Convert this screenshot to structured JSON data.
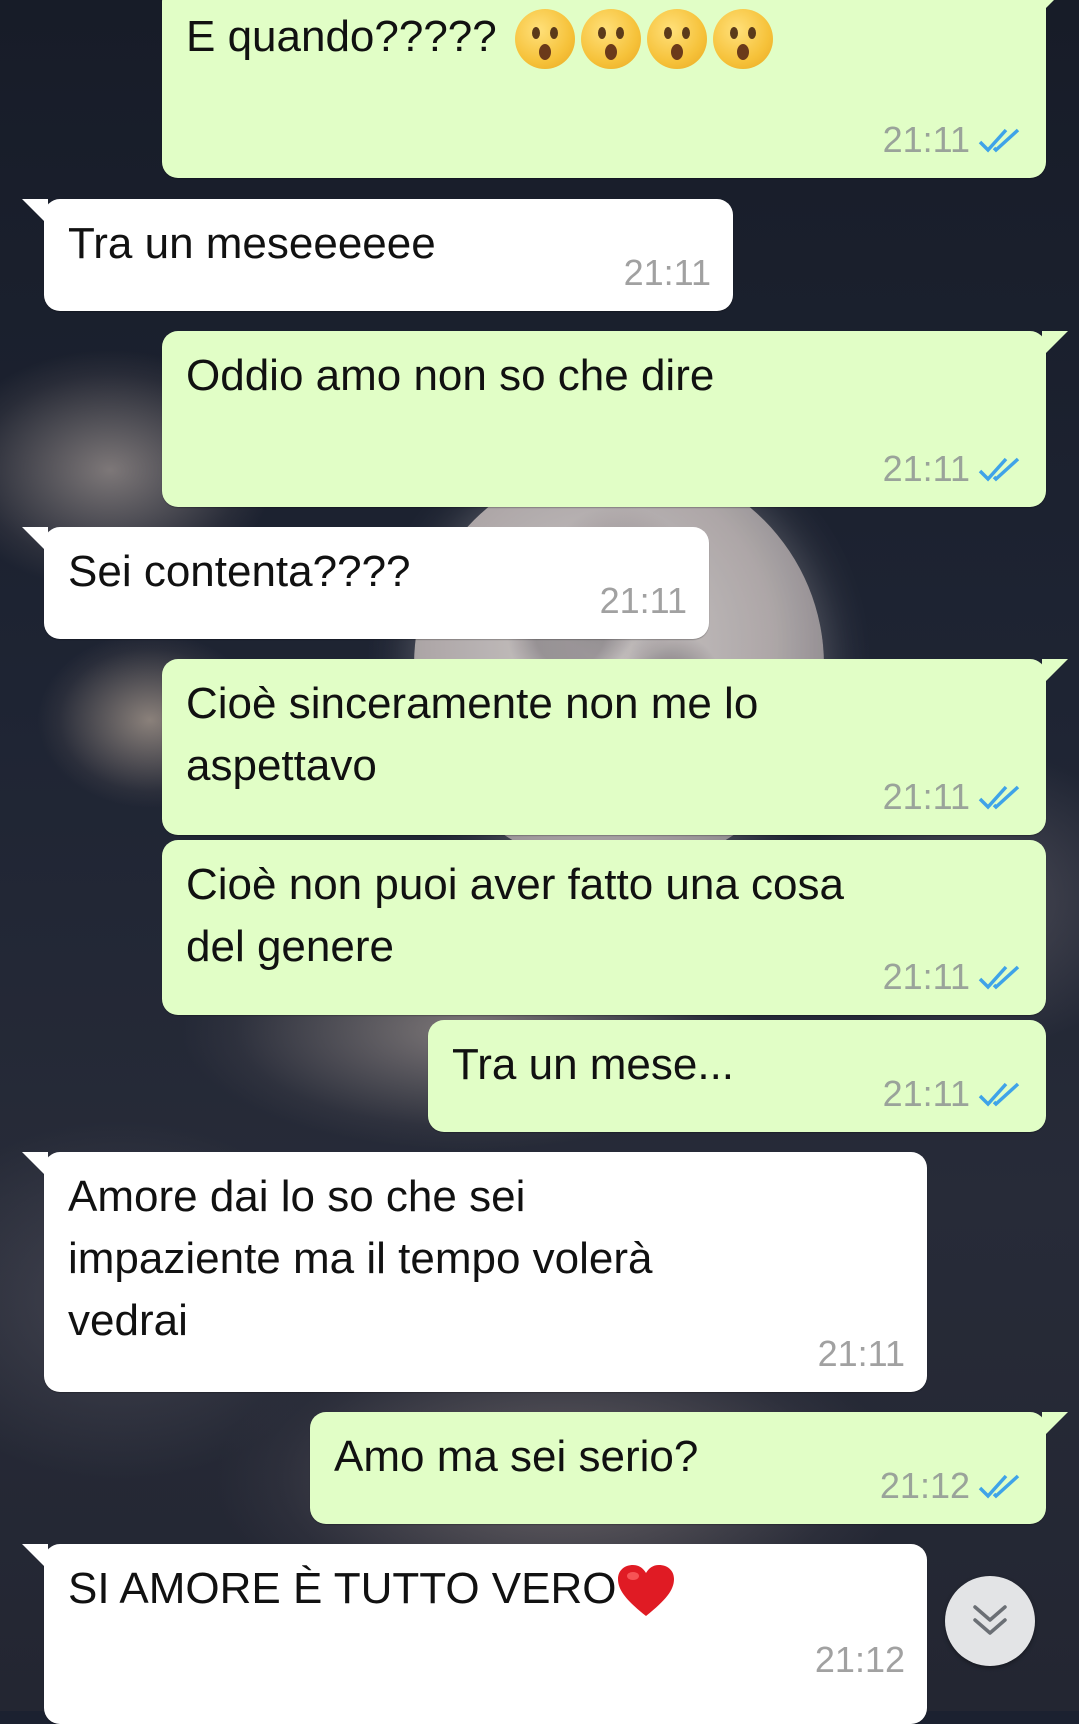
{
  "messages": [
    {
      "direction": "out",
      "text": "E quando?????",
      "emoji_count": 4,
      "emoji": "astonished-face",
      "time": "21:11",
      "status": "read"
    },
    {
      "direction": "in",
      "text": "Tra un meseeeeee",
      "time": "21:11"
    },
    {
      "direction": "out",
      "text": "Oddio amo non so che dire",
      "time": "21:11",
      "status": "read"
    },
    {
      "direction": "in",
      "text": "Sei contenta????",
      "time": "21:11"
    },
    {
      "direction": "out",
      "text": "Cioè sinceramente non me lo\naspettavo",
      "time": "21:11",
      "status": "read"
    },
    {
      "direction": "out",
      "text": "Cioè non puoi aver fatto una cosa\ndel genere",
      "time": "21:11",
      "status": "read"
    },
    {
      "direction": "out",
      "text": "Tra un mese...",
      "time": "21:11",
      "status": "read"
    },
    {
      "direction": "in",
      "text": "Amore dai lo so che sei\nimpaziente ma il tempo volerà\nvedrai",
      "time": "21:11"
    },
    {
      "direction": "out",
      "text": "Amo ma sei serio?",
      "time": "21:12",
      "status": "read"
    },
    {
      "direction": "in",
      "text": "SI AMORE È TUTTO VERO",
      "trailing_emoji": "red-heart",
      "time": "21:12"
    }
  ],
  "colors": {
    "outgoing_bubble": "#e1fec6",
    "incoming_bubble": "#ffffff",
    "read_ticks": "#3fa3e8",
    "timestamp": "#9aa39a"
  },
  "scroll_button": {
    "icon": "double-chevron-down-icon"
  }
}
